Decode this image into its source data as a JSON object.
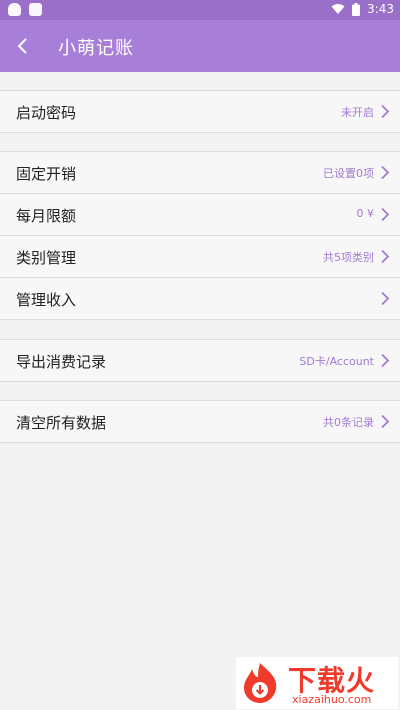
{
  "status_bar": {
    "time": "3:43"
  },
  "app_bar": {
    "title": "小萌记账"
  },
  "settings": {
    "password": {
      "label": "启动密码",
      "value": "未开启"
    },
    "fixed_expenses": {
      "label": "固定开销",
      "value": "已设置0项"
    },
    "monthly_limit": {
      "label": "每月限额",
      "value": "0 ¥"
    },
    "categories": {
      "label": "类别管理",
      "value": "共5项类别"
    },
    "income": {
      "label": "管理收入",
      "value": ""
    },
    "export": {
      "label": "导出消费记录",
      "value": "SD卡/Account"
    },
    "clear": {
      "label": "清空所有数据",
      "value": "共0条记录"
    }
  },
  "watermark": {
    "brand": "下载火",
    "domain": "xiazaihuo.com"
  },
  "colors": {
    "app_bar": "#a87fd8",
    "status_bar": "#9a6fc9",
    "accent_value": "#a27bd0",
    "watermark": "#ef3b2b"
  }
}
